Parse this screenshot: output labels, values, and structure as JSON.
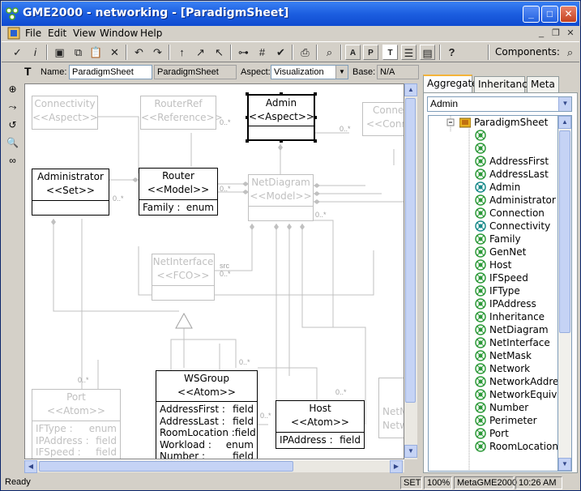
{
  "window": {
    "title": "GME2000 - networking - [ParadigmSheet]",
    "minimize": "_",
    "maximize": "□",
    "close": "✕"
  },
  "menu": {
    "file": "File",
    "edit": "Edit",
    "view": "View",
    "window": "Window",
    "help": "Help",
    "mdi_minimize": "_",
    "mdi_restore": "❐",
    "mdi_close": "✕"
  },
  "toolbar": {
    "components_label": "Components:"
  },
  "props": {
    "name_label": "Name:",
    "name_value": "ParadigmSheet",
    "kind_value": "ParadigmSheet",
    "aspect_label": "Aspect:",
    "aspect_value": "Visualization",
    "base_label": "Base:",
    "base_value": "N/A"
  },
  "diagram": {
    "connectivity": {
      "name": "Connectivity",
      "stereo": "<<Aspect>>"
    },
    "routerref": {
      "name": "RouterRef",
      "stereo": "<<Reference>>"
    },
    "admin": {
      "name": "Admin",
      "stereo": "<<Aspect>>"
    },
    "conne": {
      "name": "Conne",
      "stereo": "<<Conne"
    },
    "administrator": {
      "name": "Administrator",
      "stereo": "<<Set>>"
    },
    "router": {
      "name": "Router",
      "stereo": "<<Model>>",
      "attr_name": "Family :",
      "attr_type": "enum"
    },
    "netdiagram": {
      "name": "NetDiagram",
      "stereo": "<<Model>>"
    },
    "netinterface": {
      "name": "NetInterface",
      "stereo": "<<FCO>>"
    },
    "wsgroup": {
      "name": "WSGroup",
      "stereo": "<<Atom>>",
      "attrs": [
        {
          "n": "AddressFirst :",
          "t": "field"
        },
        {
          "n": "AddressLast :",
          "t": "field"
        },
        {
          "n": "RoomLocation :",
          "t": "field"
        },
        {
          "n": "Workload :",
          "t": "enum"
        },
        {
          "n": "Number :",
          "t": "field"
        }
      ]
    },
    "host": {
      "name": "Host",
      "stereo": "<<Atom>>",
      "attr_name": "IPAddress :",
      "attr_type": "field"
    },
    "port": {
      "name": "Port",
      "stereo": "<<Atom>>",
      "attrs": [
        {
          "n": "IFType :",
          "t": "enum"
        },
        {
          "n": "IPAddress :",
          "t": "field"
        },
        {
          "n": "IFSpeed :",
          "t": "field"
        }
      ]
    },
    "netw": {
      "name": "NetM",
      "stereo": "Netw"
    },
    "cardinalities": [
      "0..*",
      "0..*",
      "0..*",
      "0..*",
      "src",
      "0..*",
      "0..*",
      "0..*",
      "0..*",
      "0..*",
      "0..*"
    ]
  },
  "panel": {
    "tabs": [
      "Aggregate",
      "Inheritance",
      "Meta"
    ],
    "combo_value": "Admin",
    "tree_root": "ParadigmSheet",
    "tree_items": [
      {
        "label": "",
        "kind": "atom"
      },
      {
        "label": "",
        "kind": "atom"
      },
      {
        "label": "AddressFirst",
        "kind": "atom"
      },
      {
        "label": "AddressLast",
        "kind": "atom"
      },
      {
        "label": "Admin",
        "kind": "model"
      },
      {
        "label": "Administrator",
        "kind": "atom"
      },
      {
        "label": "Connection",
        "kind": "atom"
      },
      {
        "label": "Connectivity",
        "kind": "model"
      },
      {
        "label": "Family",
        "kind": "atom"
      },
      {
        "label": "GenNet",
        "kind": "atom"
      },
      {
        "label": "Host",
        "kind": "atom"
      },
      {
        "label": "IFSpeed",
        "kind": "atom"
      },
      {
        "label": "IFType",
        "kind": "atom"
      },
      {
        "label": "IPAddress",
        "kind": "atom"
      },
      {
        "label": "Inheritance",
        "kind": "atom"
      },
      {
        "label": "NetDiagram",
        "kind": "atom"
      },
      {
        "label": "NetInterface",
        "kind": "atom"
      },
      {
        "label": "NetMask",
        "kind": "atom"
      },
      {
        "label": "Network",
        "kind": "atom"
      },
      {
        "label": "NetworkAddress",
        "kind": "atom"
      },
      {
        "label": "NetworkEquiv",
        "kind": "atom"
      },
      {
        "label": "Number",
        "kind": "atom"
      },
      {
        "label": "Perimeter",
        "kind": "atom"
      },
      {
        "label": "Port",
        "kind": "atom"
      },
      {
        "label": "RoomLocation",
        "kind": "atom"
      }
    ]
  },
  "status": {
    "text": "Ready",
    "mode": "SET",
    "zoom": "100%",
    "paradigm": "MetaGME2000",
    "time": "10:26 AM"
  },
  "colors": {
    "atom_icon": "#2e9a3a",
    "model_icon": "#1a8a8a",
    "folder": "#e8b020"
  }
}
